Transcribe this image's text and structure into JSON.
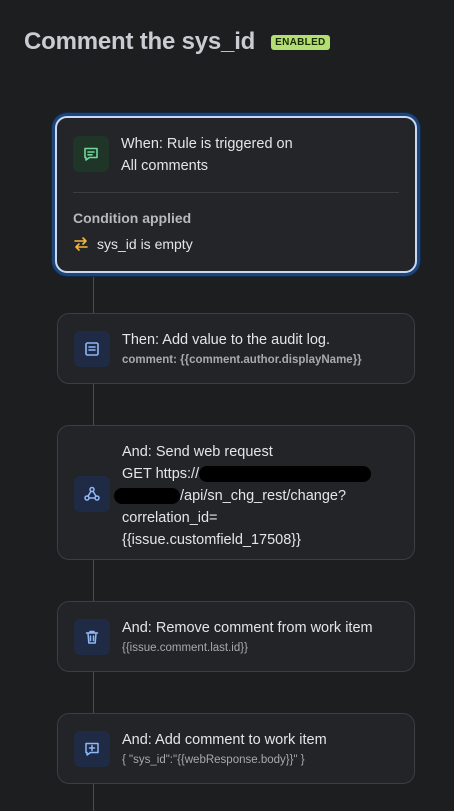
{
  "header": {
    "title": "Comment the sys_id",
    "status": "ENABLED"
  },
  "trigger": {
    "icon": "comment-icon",
    "line1": "When: Rule is triggered on",
    "line2": "All comments",
    "condition_title": "Condition applied",
    "condition_icon": "swap-arrows-icon",
    "condition_text": "sys_id is empty"
  },
  "actions": [
    {
      "icon": "audit-log-icon",
      "title": "Then: Add value to the audit log.",
      "detail": "comment: {{comment.author.displayName}}"
    },
    {
      "icon": "webhook-icon",
      "title": "And: Send web request",
      "detail_lines": [
        "GET https://",
        "/api/sn_chg_rest/change?",
        "correlation_id=",
        "{{issue.customfield_17508}}"
      ]
    },
    {
      "icon": "trash-icon",
      "title": "And: Remove comment from work item",
      "detail": "{{issue.comment.last.id}}"
    },
    {
      "icon": "add-comment-icon",
      "title": "And: Add comment to work item",
      "detail": "{ \"sys_id\":\"{{webResponse.body}}\" }"
    }
  ],
  "colors": {
    "background": "#1d1e20",
    "card": "#232427",
    "badge": "#b3df72",
    "trigger_border": "#c7d9f4",
    "icon_blue": "#8fb8f6",
    "icon_green": "#6fd89a",
    "condition_icon": "#f5b73b"
  }
}
